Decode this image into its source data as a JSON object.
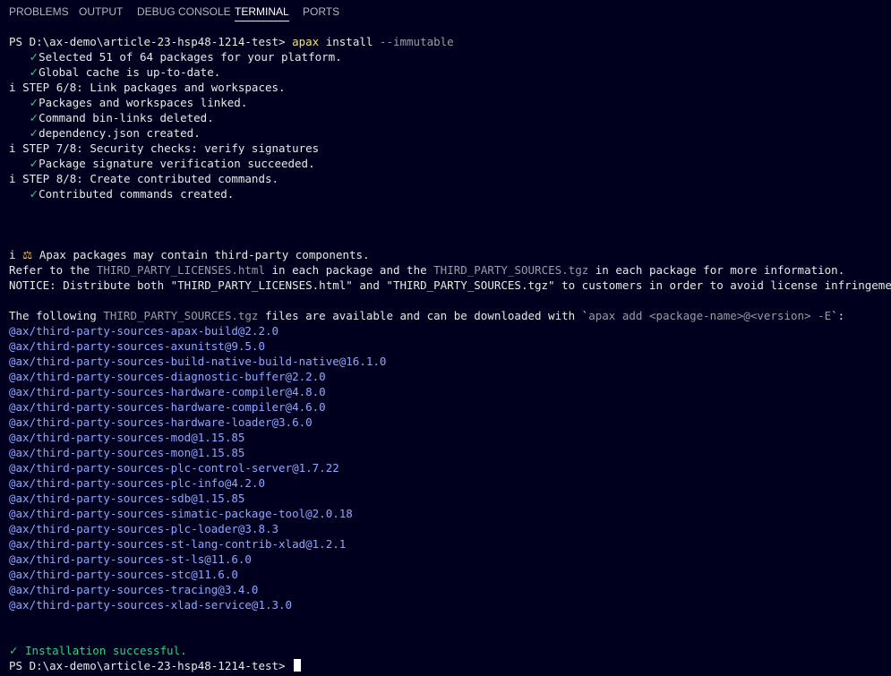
{
  "panel": {
    "tabs": [
      {
        "label": "PROBLEMS"
      },
      {
        "label": "OUTPUT"
      },
      {
        "label": "DEBUG CONSOLE"
      },
      {
        "label": "TERMINAL"
      },
      {
        "label": "PORTS"
      }
    ],
    "active_tab": "TERMINAL"
  },
  "terminal": {
    "prompt": "PS D:\\ax-demo\\article-23-hsp48-1214-test> ",
    "command": {
      "program": "apax",
      "args": " install ",
      "flag": "--immutable"
    },
    "check_glyph": "✓",
    "info_glyph": "i",
    "scales_icon": "⚖",
    "install_steps": [
      {
        "kind": "ok",
        "text": "Selected 51 of 64 packages for your platform."
      },
      {
        "kind": "ok",
        "text": "Global cache is up-to-date."
      },
      {
        "kind": "step",
        "text": "STEP 6/8: Link packages and workspaces."
      },
      {
        "kind": "ok",
        "text": "Packages and workspaces linked."
      },
      {
        "kind": "ok",
        "text": "Command bin-links deleted."
      },
      {
        "kind": "ok",
        "text": "dependency.json created."
      },
      {
        "kind": "step",
        "text": "STEP 7/8: Security checks: verify signatures"
      },
      {
        "kind": "ok",
        "text": "Package signature verification succeeded."
      },
      {
        "kind": "step",
        "text": "STEP 8/8: Create contributed commands."
      },
      {
        "kind": "ok",
        "text": "Contributed commands created."
      }
    ],
    "notice": {
      "line1": "Apax packages may contain third-party components.",
      "line2_a": "Refer to the ",
      "line2_file1": "THIRD_PARTY_LICENSES.html",
      "line2_b": " in each package and the ",
      "line2_file2": "THIRD_PARTY_SOURCES.tgz",
      "line2_c": " in each package for more information.",
      "line3": "NOTICE: Distribute both \"THIRD_PARTY_LICENSES.html\" and \"THIRD_PARTY_SOURCES.tgz\" to customers in order to avoid license infringements.",
      "line4_a": "The following ",
      "line4_file": "THIRD_PARTY_SOURCES.tgz",
      "line4_b": " files are available and can be downloaded with `",
      "line4_cmd": "apax add <package-name>@<version> -E",
      "line4_c": "`:"
    },
    "packages": [
      "@ax/third-party-sources-apax-build@2.2.0",
      "@ax/third-party-sources-axunitst@9.5.0",
      "@ax/third-party-sources-build-native-build-native@16.1.0",
      "@ax/third-party-sources-diagnostic-buffer@2.2.0",
      "@ax/third-party-sources-hardware-compiler@4.8.0",
      "@ax/third-party-sources-hardware-compiler@4.6.0",
      "@ax/third-party-sources-hardware-loader@3.6.0",
      "@ax/third-party-sources-mod@1.15.85",
      "@ax/third-party-sources-mon@1.15.85",
      "@ax/third-party-sources-plc-control-server@1.7.22",
      "@ax/third-party-sources-plc-info@4.2.0",
      "@ax/third-party-sources-sdb@1.15.85",
      "@ax/third-party-sources-simatic-package-tool@2.0.18",
      "@ax/third-party-sources-plc-loader@3.8.3",
      "@ax/third-party-sources-st-lang-contrib-xlad@1.2.1",
      "@ax/third-party-sources-st-ls@11.6.0",
      "@ax/third-party-sources-stc@11.6.0",
      "@ax/third-party-sources-tracing@3.4.0",
      "@ax/third-party-sources-xlad-service@1.3.0"
    ],
    "success": "Installation successful."
  }
}
